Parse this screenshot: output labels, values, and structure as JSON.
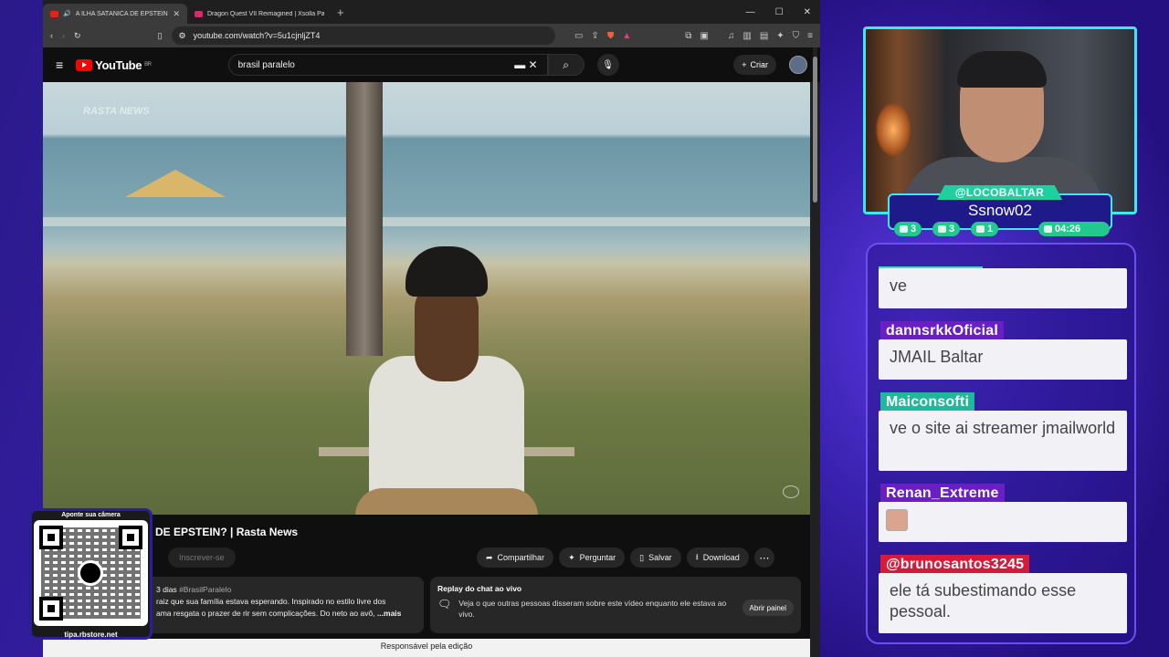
{
  "browser": {
    "tabs": [
      {
        "title": "A ILHA SATÂNICA DE EPSTEIN? | Ra",
        "active": true
      },
      {
        "title": "Dragon Quest VII Reimagined | Xsolla Partne",
        "active": false
      }
    ],
    "new_tab": "+",
    "window_controls": [
      "—",
      "☐",
      "✕"
    ],
    "url": "youtube.com/watch?v=5u1cjnljZT4"
  },
  "youtube": {
    "logo": "YouTube",
    "logo_region": "BR",
    "search_value": "brasil paralelo",
    "create_label": "Criar"
  },
  "video": {
    "watermark": "RASTA NEWS",
    "title": "DE EPSTEIN? | Rasta News",
    "subscribe_label": "Inscrever-se",
    "actions": [
      {
        "icon": "share-icon",
        "label": "Compartilhar"
      },
      {
        "icon": "sparkle-icon",
        "label": "Perguntar"
      },
      {
        "icon": "save-icon",
        "label": "Salvar"
      },
      {
        "icon": "download-icon",
        "label": "Download"
      }
    ],
    "more_label": "⋯",
    "description": {
      "age": "3 dias",
      "hashtag": "#BrasilParalelo",
      "line1": "raiz que sua família estava esperando. Inspirado no estilo livre dos",
      "line2": "ama resgata o prazer de rir sem complicações. Do neto ao avô,",
      "more": "...mais"
    },
    "chat_replay": {
      "heading": "Replay do chat ao vivo",
      "text": "Veja o que outras pessoas disseram sobre este vídeo enquanto ele estava ao vivo.",
      "button": "Abrir painel"
    },
    "footer": "Responsável pela edição"
  },
  "qr": {
    "caption": "Aponte sua câmera",
    "url": "tipa.rbstore.net"
  },
  "stream": {
    "handle": "@LOCOBALTAR",
    "name": "Ssnow02",
    "stats": [
      {
        "icon": "chat-icon",
        "value": "3"
      },
      {
        "icon": "youtube-icon",
        "value": "3"
      },
      {
        "icon": "users-icon",
        "value": "1"
      },
      {
        "icon": "clock-icon",
        "value": "04:26"
      }
    ]
  },
  "chat": [
    {
      "user": "",
      "text": "ve",
      "user_color": ""
    },
    {
      "user": "dannsrkkOficial",
      "text": "JMAIL Baltar",
      "user_color": "#6a1fc4"
    },
    {
      "user": "Maiconsofti",
      "text": "ve o site ai streamer jmailworld",
      "user_color": "#1fb89a"
    },
    {
      "user": "Renan_Extreme",
      "text": "",
      "user_color": "#6a1fc4"
    },
    {
      "user": "@brunosantos3245",
      "text": "ele tá subestimando esse pessoal.",
      "user_color": "#d81a3a"
    }
  ],
  "colors": {
    "accent_cyan": "#3fe8f0",
    "accent_green": "#22c98f",
    "youtube_red": "#ff0000"
  }
}
